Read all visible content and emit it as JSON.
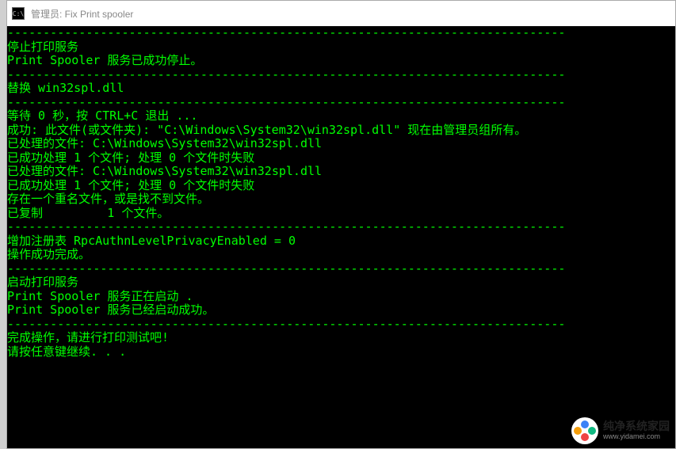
{
  "titlebar": {
    "icon_label": "C:\\",
    "title": "管理员:  Fix Print spooler"
  },
  "console": {
    "lines": [
      "------------------------------------------------------------------------------",
      "停止打印服务",
      "",
      "Print Spooler 服务已成功停止。",
      "",
      "------------------------------------------------------------------------------",
      "替换 win32spl.dll",
      "------------------------------------------------------------------------------",
      "",
      "等待 0 秒，按 CTRL+C 退出 ...",
      "",
      "成功: 此文件(或文件夹): \"C:\\Windows\\System32\\win32spl.dll\" 现在由管理员组所有。",
      "已处理的文件: C:\\Windows\\System32\\win32spl.dll",
      "已成功处理 1 个文件; 处理 0 个文件时失败",
      "已处理的文件: C:\\Windows\\System32\\win32spl.dll",
      "已成功处理 1 个文件; 处理 0 个文件时失败",
      "存在一个重名文件，或是找不到文件。",
      "已复制         1 个文件。",
      "------------------------------------------------------------------------------",
      "增加注册表 RpcAuthnLevelPrivacyEnabled = 0",
      "",
      "操作成功完成。",
      "------------------------------------------------------------------------------",
      "启动打印服务",
      "Print Spooler 服务正在启动 .",
      "Print Spooler 服务已经启动成功。",
      "",
      "------------------------------------------------------------------------------",
      "完成操作，请进行打印测试吧!",
      "请按任意键继续. . ."
    ]
  },
  "watermark": {
    "name": "纯净系统家园",
    "url": "www.yidamei.com"
  }
}
